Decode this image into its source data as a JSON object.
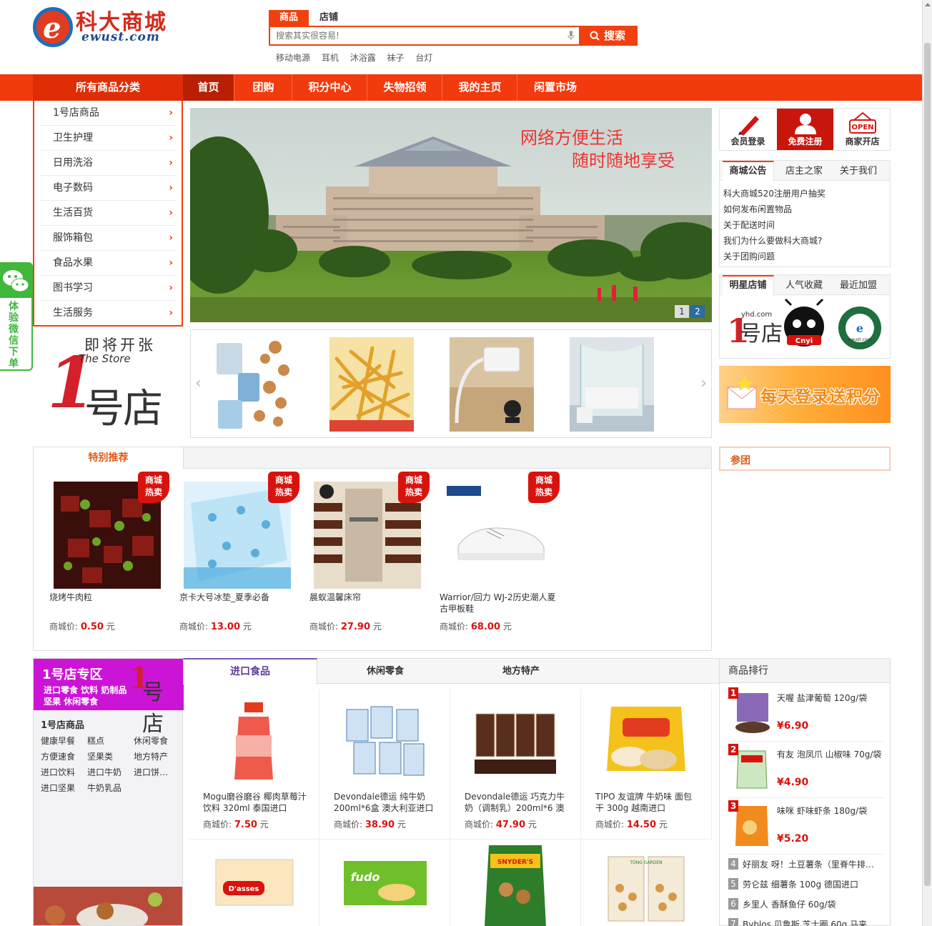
{
  "logo": {
    "title": "科大商城",
    "domain": "ewust.com",
    "mark": "e"
  },
  "search": {
    "tabs": [
      "商品",
      "店铺"
    ],
    "placeholder": "搜索其实很容易!",
    "button": "搜索",
    "hot_words": [
      "移动电源",
      "耳机",
      "沐浴露",
      "袜子",
      "台灯"
    ]
  },
  "nav": {
    "all_categories": "所有商品分类",
    "items": [
      "首页",
      "团购",
      "积分中心",
      "失物招领",
      "我的主页",
      "闲置市场"
    ]
  },
  "categories": [
    "1号店商品",
    "卫生护理",
    "日用洗浴",
    "电子数码",
    "生活百货",
    "服饰箱包",
    "食品水果",
    "图书学习",
    "生活服务"
  ],
  "banner": {
    "slogan1": "网络方便生活",
    "slogan2": "随时随地享受",
    "dots": [
      "1",
      "2"
    ]
  },
  "store_promo": {
    "coming": "即将开张",
    "the_store": "The Store",
    "number": "1",
    "name": "号店"
  },
  "user_box": {
    "login": "会员登录",
    "register": "免费注册",
    "open_shop": "商家开店",
    "open_sign": "OPEN"
  },
  "notice": {
    "tabs": [
      "商城公告",
      "店主之家",
      "关于我们"
    ],
    "lines": [
      "科大商城520注册用户抽奖",
      "如何发布闲置物品",
      "关于配送时间",
      "我们为什么要做科大商城?",
      "关于团购问题"
    ]
  },
  "stars": {
    "tabs": [
      "明星店铺",
      "人气收藏",
      "最近加盟"
    ],
    "shops": [
      "yhd.com",
      "Cnyi",
      "ewust.com"
    ]
  },
  "daily_ad": "每天登录送积分",
  "special": {
    "title": "特别推荐",
    "badge": [
      "商城",
      "热卖"
    ],
    "price_label": "商城价:",
    "unit": "元",
    "products": [
      {
        "name": "烧烤牛肉粒",
        "price": "0.50"
      },
      {
        "name": "京卡大号冰垫_夏季必备",
        "price": "13.00"
      },
      {
        "name": "晨蚁温馨床帘",
        "price": "27.90"
      },
      {
        "name": "Warrior/回力 WJ-2历史潮人夏古甲板鞋",
        "price": "68.00"
      }
    ]
  },
  "tuan": "参团",
  "zone": {
    "title": "1号店专区",
    "subtitle": "进口零食 饮料 奶制品 坚果 休闲零食",
    "logo_num": "1",
    "logo_text": "号店",
    "section": "1号店商品",
    "links": [
      "健康早餐",
      "糕点",
      "休闲零食",
      "方便速食",
      "坚果类",
      "地方特产",
      "进口饮料",
      "进口牛奶",
      "进口饼…",
      "进口坚果",
      "牛奶乳品"
    ]
  },
  "food": {
    "tabs": [
      "进口食品",
      "休闲零食",
      "地方特产"
    ],
    "price_label": "商城价:",
    "unit": "元",
    "products": [
      {
        "name": "Mogu磨谷磨谷 椰肉草莓汁饮料 320ml 泰国进口",
        "price": "7.50"
      },
      {
        "name": "Devondale德运 纯牛奶 200ml*6盒 澳大利亚进口",
        "price": "38.90"
      },
      {
        "name": "Devondale德运 巧克力牛奶（调制乳）200ml*6 澳",
        "price": "47.90"
      },
      {
        "name": "TIPO 友谊牌 牛奶味 面包干 300g 越南进口",
        "price": "14.50"
      }
    ],
    "row2_labels": [
      "D'asses",
      "fudo",
      "SNYDER'S",
      "TONG GARDEN"
    ]
  },
  "rank": {
    "title": "商品排行",
    "top": [
      {
        "num": "1",
        "name": "天喔 盐津葡萄 120g/袋",
        "price": "¥6.90"
      },
      {
        "num": "2",
        "name": "有友 泡凤爪 山椒味 70g/袋",
        "price": "¥4.90"
      },
      {
        "num": "3",
        "name": "味咪 虾味虾条 180g/袋",
        "price": "¥5.20"
      }
    ],
    "others": [
      {
        "num": "4",
        "name": "好丽友 呀！土豆薯条（里脊牛排…"
      },
      {
        "num": "5",
        "name": "劳仑兹 细薯条 100g 德国进口"
      },
      {
        "num": "6",
        "name": "乡里人 香酥鱼仔 60g/袋"
      },
      {
        "num": "7",
        "name": "Byblos 贝鲁斯 芝士圈 60g 马来"
      }
    ]
  },
  "wechat": {
    "text": "体验微信下单"
  },
  "colors": {
    "brand": "#f13a0d",
    "price": "#d8130e",
    "wechat": "#3fb83c",
    "zone": "#cc14d6"
  }
}
